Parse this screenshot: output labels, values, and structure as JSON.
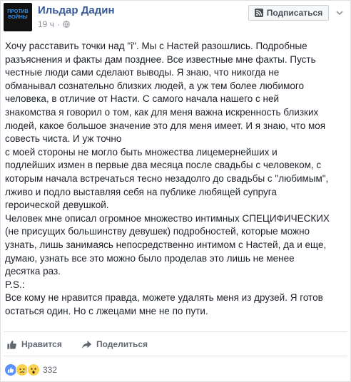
{
  "post": {
    "author": "Ильдар Дадин",
    "timestamp": "19 ч",
    "subscribe_label": "Подписаться",
    "avatar_text": [
      "ПРОТИВ",
      "ВОЙНЫ"
    ],
    "lines": [
      "Хочу расставить точки над \"i\". Мы с Настей разошлись. Подробные",
      "разъяснения и факты дам позднее. Все известные мне факты. Пусть",
      "честные люди сами сделают выводы. Я знаю, что никогда не",
      "обманывал сознательно близких людей, а уж тем более любимого",
      "человека, в отличие от Насти. С самого начала нашего с ней",
      "знакомства я говорил о том, как для меня важна искренность близких",
      "людей, какое большое значение это для меня имеет. И я знаю, что моя",
      "совесть чиста. И уж точно",
      "с моей стороны не могло быть множества лицемернейших и",
      "подлейших измен в первые два месяца после свадьбы с человеком, с",
      "которым начала встречаться тесно незадолго до свадьбы с \"любимым\",",
      "лживо и подло выставляя себя на публике любящей супруга",
      "героической девушкой.",
      "Человек мне описал огромное множество интимных СПЕЦИФИЧЕСКИХ",
      "(не присущих большинству девушек) подробностей, которые можно",
      "узнать, лишь занимаясь непосредственно интимом с Настей, да и еще,",
      "думаю, узнать все это можно было проделав это лишь не менее",
      "десятка раз.",
      "P.S.:",
      "Все кому не нравится правда, можете удалять меня из друзей. Я готов",
      "остаться один. Но с лжецами мне не по пути."
    ]
  },
  "actions": {
    "like_label": "Нравится",
    "share_label": "Поделиться"
  },
  "reactions": {
    "icons": [
      "like-icon",
      "sad-icon",
      "wow-icon"
    ],
    "count": "332"
  },
  "colors": {
    "author": "#365899",
    "meta": "#90949c",
    "like_blue": "#5890ff",
    "reaction_yellow": "#fcd14f"
  }
}
